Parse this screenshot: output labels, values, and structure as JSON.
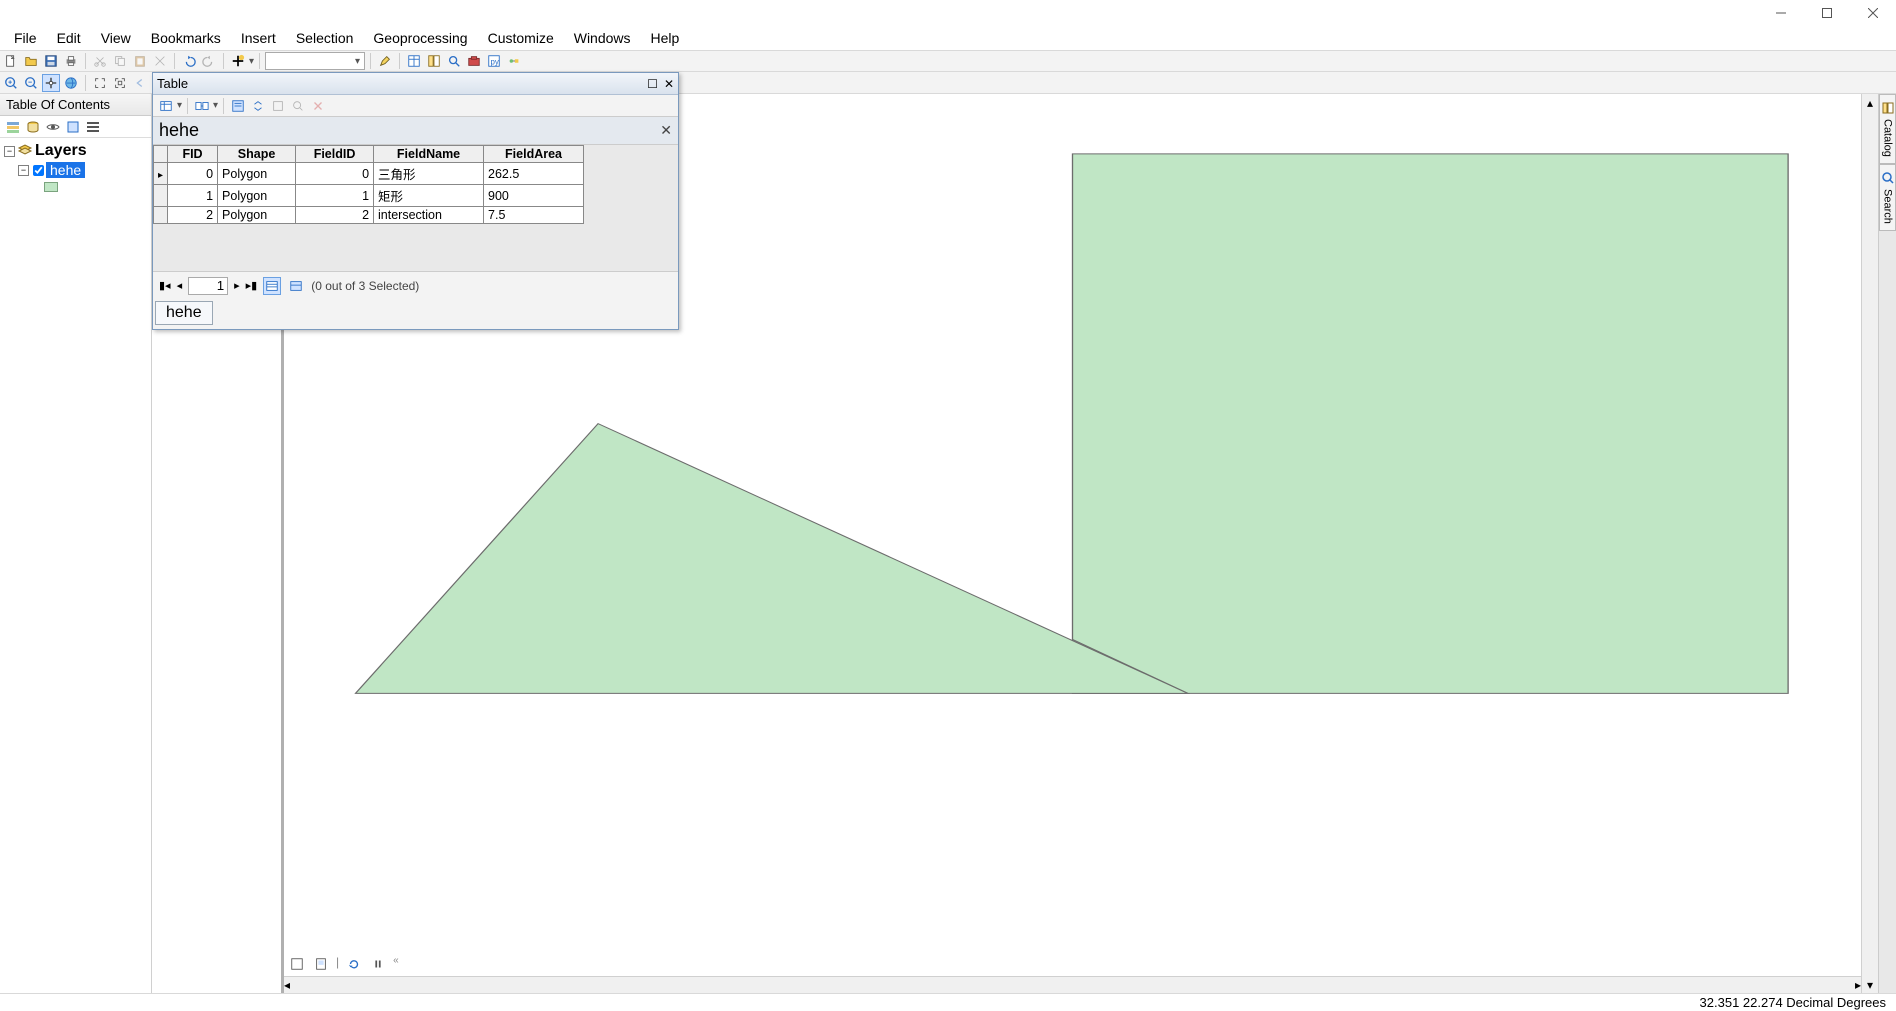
{
  "window": {
    "title": ""
  },
  "menu": [
    "File",
    "Edit",
    "View",
    "Bookmarks",
    "Insert",
    "Selection",
    "Geoprocessing",
    "Customize",
    "Windows",
    "Help"
  ],
  "toc": {
    "title": "Table Of Contents",
    "root": "Layers",
    "layer": "hehe"
  },
  "attr_table": {
    "window_title": "Table",
    "layer_name": "hehe",
    "columns": [
      "FID",
      "Shape",
      "FieldID",
      "FieldName",
      "FieldArea"
    ],
    "rows": [
      {
        "FID": "0",
        "Shape": "Polygon",
        "FieldID": "0",
        "FieldName": "三角形",
        "FieldArea": "262.5",
        "current": true
      },
      {
        "FID": "1",
        "Shape": "Polygon",
        "FieldID": "1",
        "FieldName": "矩形",
        "FieldArea": "900",
        "current": false
      },
      {
        "FID": "2",
        "Shape": "Polygon",
        "FieldID": "2",
        "FieldName": "intersection",
        "FieldArea": "7.5",
        "current": false
      }
    ],
    "nav_pos": "1",
    "selection_info": "(0 out of 3 Selected)",
    "tab_label": "hehe"
  },
  "side_tabs": [
    "Catalog",
    "Search"
  ],
  "status": {
    "coords": "32.351  22.274 Decimal Degrees"
  }
}
